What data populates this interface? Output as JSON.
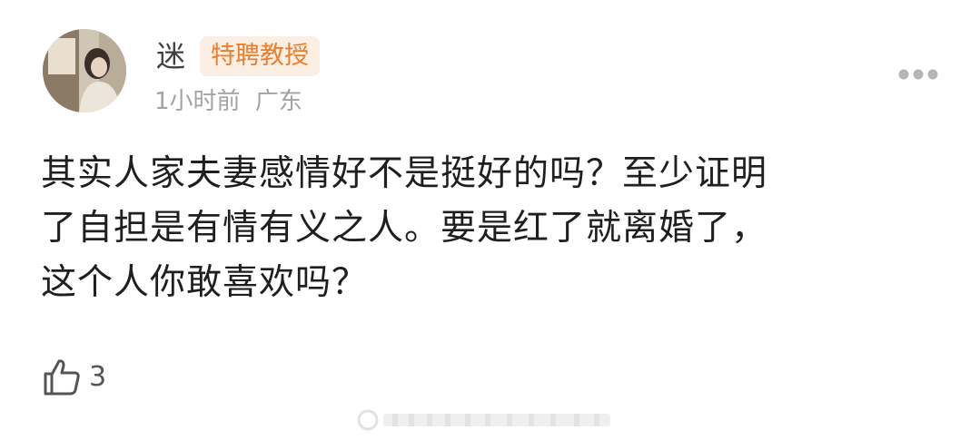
{
  "comment": {
    "username": "迷",
    "badge": "特聘教授",
    "time": "1小时前",
    "location": "广东",
    "content_lines": [
      "其实人家夫妻感情好不是挺好的吗？至少证明",
      "了自担是有情有义之人。要是红了就离婚了，",
      "这个人你敢喜欢吗？"
    ],
    "like_count": "3"
  },
  "icons": {
    "more": "more-dots-icon",
    "like": "thumbs-up-icon",
    "watermark": "watermark-icon"
  },
  "colors": {
    "badge_text": "#e97f2e",
    "badge_bg": "#fbeee3",
    "meta_text": "#a3a3a3"
  }
}
